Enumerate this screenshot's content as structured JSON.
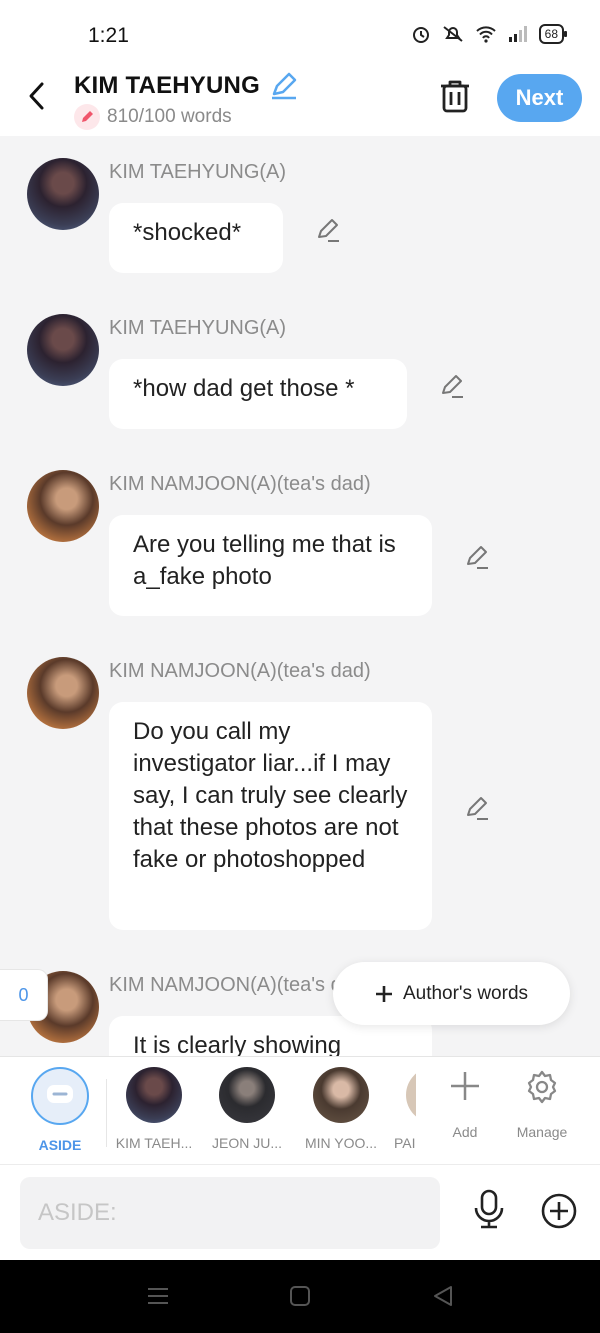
{
  "status_bar": {
    "time": "1:21",
    "battery": "68"
  },
  "header": {
    "title": "KIM TAEHYUNG",
    "word_count": "810/100 words",
    "next_label": "Next"
  },
  "messages": [
    {
      "sender": "KIM TAEHYUNG(A)",
      "text": "*shocked*"
    },
    {
      "sender": "KIM TAEHYUNG(A)",
      "text": "*how dad get those *"
    },
    {
      "sender": "KIM NAMJOON(A)(tea's dad)",
      "text": "Are you telling me that is a_fake photo"
    },
    {
      "sender": "KIM NAMJOON(A)(tea's dad)",
      "text": "Do you call my investigator liar...if I may say, I can truly see clearly that these photos are not fake or photoshopped"
    },
    {
      "sender": "KIM NAMJOON(A)(tea's dad)",
      "text": "It is clearly showing"
    }
  ],
  "floating": {
    "counter": "0",
    "author_words": "Author's words"
  },
  "characters": [
    {
      "label": "ASIDE"
    },
    {
      "label": "KIM TAEH..."
    },
    {
      "label": "JEON JU..."
    },
    {
      "label": "MIN YOO..."
    },
    {
      "label": "PAI"
    }
  ],
  "actions": {
    "add": "Add",
    "manage": "Manage"
  },
  "input": {
    "placeholder": "ASIDE:"
  },
  "colors": {
    "accent": "#58a7f0",
    "background": "#f4f4f5"
  }
}
